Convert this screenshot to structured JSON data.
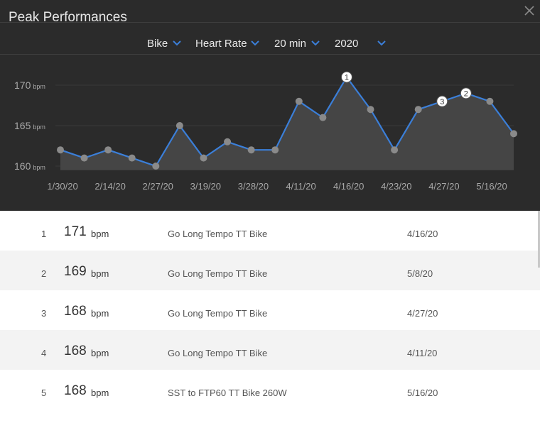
{
  "header": {
    "title": "Peak Performances",
    "close_icon": "close-icon"
  },
  "filters": [
    {
      "key": "sport",
      "value": "Bike"
    },
    {
      "key": "metric",
      "value": "Heart Rate"
    },
    {
      "key": "duration",
      "value": "20 min"
    },
    {
      "key": "year",
      "value": "2020"
    }
  ],
  "colors": {
    "accent": "#3b7fd9",
    "background": "#2b2b2b",
    "point": "#8a8a8a"
  },
  "chart_data": {
    "type": "area",
    "unit": "bpm",
    "x_ticks": [
      "1/30/20",
      "2/14/20",
      "2/27/20",
      "3/19/20",
      "3/28/20",
      "4/11/20",
      "4/16/20",
      "4/23/20",
      "4/27/20",
      "5/16/20"
    ],
    "y_ticks": [
      {
        "value": 170,
        "label": "170",
        "unit": "bpm"
      },
      {
        "value": 165,
        "label": "165",
        "unit": "bpm"
      },
      {
        "value": 160,
        "label": "160",
        "unit": "bpm"
      }
    ],
    "ylim": [
      159.5,
      171
    ],
    "values": [
      162,
      161,
      162,
      161,
      160,
      165,
      161,
      163,
      162,
      162,
      168,
      166,
      171,
      167,
      162,
      167,
      168,
      169,
      168,
      164
    ],
    "ranked_points": [
      {
        "rank": "1",
        "index": 12
      },
      {
        "rank": "2",
        "index": 17
      },
      {
        "rank": "3",
        "index": 16
      }
    ]
  },
  "table": {
    "unit": "bpm",
    "rows": [
      {
        "rank": "1",
        "value": "171",
        "workout": "Go Long Tempo TT Bike",
        "date": "4/16/20"
      },
      {
        "rank": "2",
        "value": "169",
        "workout": "Go Long Tempo TT Bike",
        "date": "5/8/20"
      },
      {
        "rank": "3",
        "value": "168",
        "workout": "Go Long Tempo TT Bike",
        "date": "4/27/20"
      },
      {
        "rank": "4",
        "value": "168",
        "workout": "Go Long Tempo TT Bike",
        "date": "4/11/20"
      },
      {
        "rank": "5",
        "value": "168",
        "workout": "SST to FTP60 TT Bike 260W",
        "date": "5/16/20"
      }
    ]
  }
}
